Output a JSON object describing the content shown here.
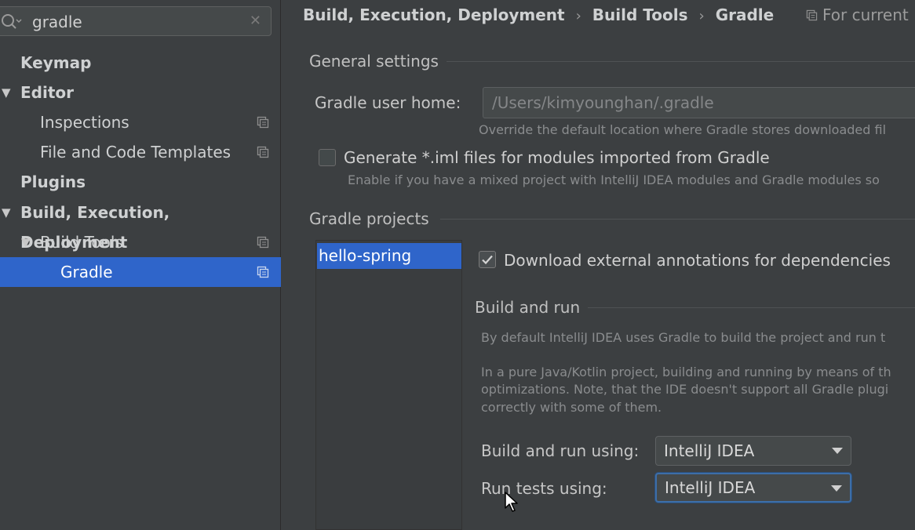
{
  "search": {
    "value": "gradle",
    "icon": "search-icon",
    "clear_icon": "close-icon"
  },
  "sidebar": {
    "items": [
      {
        "label": "Keymap"
      },
      {
        "label": "Editor"
      },
      {
        "label": "Inspections"
      },
      {
        "label": "File and Code Templates"
      },
      {
        "label": "Plugins"
      },
      {
        "label": "Build, Execution, Deployment"
      },
      {
        "label": "Build Tools"
      },
      {
        "label": "Gradle"
      }
    ],
    "expand_glyph": "▼"
  },
  "breadcrumb": {
    "items": [
      "Build, Execution, Deployment",
      "Build Tools",
      "Gradle"
    ],
    "separator": "›"
  },
  "scope_label": "For current",
  "general": {
    "title": "General settings",
    "user_home_label": "Gradle user home:",
    "user_home_value": "/Users/kimyounghan/.gradle",
    "user_home_hint": "Override the default location where Gradle stores downloaded fil",
    "iml_label": "Generate *.iml files for modules imported from Gradle",
    "iml_checked": false,
    "iml_hint": "Enable if you have a mixed project with IntelliJ IDEA modules and Gradle modules so"
  },
  "projects": {
    "title": "Gradle projects",
    "list": [
      "hello-spring"
    ],
    "download_annotations_label": "Download external annotations for dependencies",
    "download_annotations_checked": true
  },
  "build_run": {
    "title": "Build and run",
    "desc1": "By default IntelliJ IDEA uses Gradle to build the project and run t",
    "desc2_lines": [
      "In a pure Java/Kotlin project, building and running by means of th",
      "optimizations. Note, that the IDE doesn't support all Gradle plugi",
      "correctly with some of them."
    ],
    "build_using_label": "Build and run using:",
    "build_using_value": "IntelliJ IDEA",
    "tests_using_label": "Run tests using:",
    "tests_using_value": "IntelliJ IDEA"
  },
  "colors": {
    "background": "#3c3f41",
    "selection": "#2f65ca",
    "focus": "#3d6ea8"
  }
}
